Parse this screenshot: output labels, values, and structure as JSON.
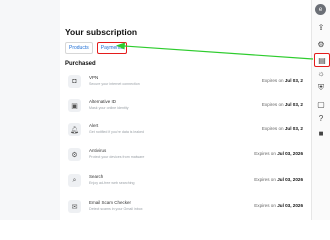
{
  "page": {
    "title": "Your subscription",
    "tabs": [
      {
        "label": "Products"
      },
      {
        "label": "Payments"
      }
    ],
    "section_title": "Purchased"
  },
  "products": [
    {
      "name": "VPN",
      "desc": "Secure your internet connection",
      "exp_prefix": "Expires on",
      "exp_date": "Jul 03, 2",
      "icon": "vpn-shield-icon"
    },
    {
      "name": "Alternative ID",
      "desc": "Mask your online identity",
      "exp_prefix": "Expires on",
      "exp_date": "Jul 03, 2",
      "icon": "id-card-icon"
    },
    {
      "name": "Alert",
      "desc": "Get notified if you're data is leaked",
      "exp_prefix": "Expires on",
      "exp_date": "Jul 03, 2",
      "icon": "bell-icon"
    },
    {
      "name": "Antivirus",
      "desc": "Protect your devices from malware",
      "exp_prefix": "Expires on",
      "exp_date": "Jul 03, 2026",
      "icon": "antivirus-icon"
    },
    {
      "name": "Search",
      "desc": "Enjoy ad-free web searching",
      "exp_prefix": "Expires on",
      "exp_date": "Jul 03, 2026",
      "icon": "search-icon"
    },
    {
      "name": "Email Scam Checker",
      "desc": "Detect scams in your Gmail inbox",
      "exp_prefix": "Expires on",
      "exp_date": "Jul 03, 2026",
      "icon": "email-check-icon"
    }
  ],
  "rail": {
    "avatar_initial": "e",
    "icons": [
      "account-icon",
      "upload-icon",
      "settings-icon",
      "subscription-icon",
      "bulb-icon",
      "shield-icon",
      "doc-icon",
      "help-icon",
      "book-icon"
    ]
  },
  "colors": {
    "accent": "#1f6fd6",
    "highlight": "#e41c1c",
    "arrow": "#2ecc2e"
  }
}
